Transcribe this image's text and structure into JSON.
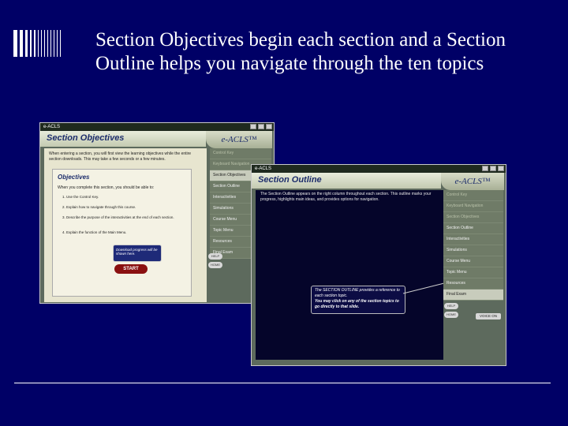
{
  "slide": {
    "title": "Section Objectives begin each section and a Section Outline helps you navigate through the ten topics"
  },
  "window_a": {
    "titlebar": "e-ACLS",
    "header": "Section Objectives",
    "logo": "e-ACLS™",
    "intro": "When entering a section, you will first view the learning objectives while the entire section downloads. This may take a few seconds or a few minutes.",
    "objectives_heading": "Objectives",
    "objectives_sub": "When you complete this section, you should be able to:",
    "objectives": [
      "1. Use the Control Key.",
      "2. Explain how to navigate through this course.",
      "3. Describe the purpose of the interactivities at the end of each section.",
      "4. Explain the function of the Main Menu."
    ],
    "tooltip": "Download progress will be shown here.",
    "start_label": "START",
    "nav_items": [
      "Control Key",
      "Keyboard Navigation",
      "Section Objectives",
      "Section Outline",
      "Interactivities",
      "Simulations",
      "Course Menu",
      "Topic Menu",
      "Resources",
      "Final Exam"
    ],
    "help_label": "HELP",
    "home_label": "HOME"
  },
  "window_b": {
    "titlebar": "e-ACLS",
    "header": "Section Outline",
    "logo": "e-ACLS™",
    "intro": "The Section Outline appears on the right column throughout each section. This outline marks your progress, highlights main ideas, and provides options for navigation.",
    "tooltip_line1": "The SECTION OUTLINE provides a reference to each section topic.",
    "tooltip_line2": "You may click on any of the section topics to go directly to that slide.",
    "nav_items": [
      "Control Key",
      "Keyboard Navigation",
      "Section Objectives",
      "Section Outline",
      "Interactivities",
      "Simulations",
      "Course Menu",
      "Topic Menu",
      "Resources",
      "Final Exam"
    ],
    "help_label": "HELP",
    "home_label": "HOME",
    "voice_label": "VOICE ON"
  }
}
